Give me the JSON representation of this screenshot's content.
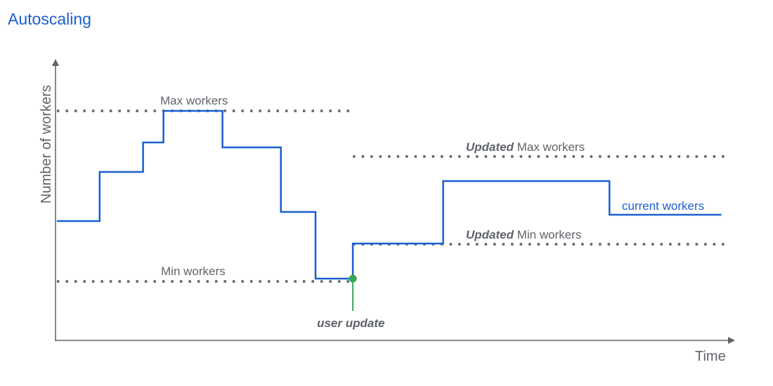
{
  "title": "Autoscaling",
  "colors": {
    "title": "#1a5fd1",
    "step_line": "#1a5fd1",
    "reference_lines": "#5f6368",
    "axis": "#5f6368",
    "user_update": "#34a853"
  },
  "chart_data": {
    "type": "line",
    "title": "Autoscaling",
    "xlabel": "Time",
    "ylabel": "Number of workers",
    "xlim": [
      0,
      100
    ],
    "ylim": [
      0,
      100
    ],
    "grid": false,
    "ticks": false,
    "series": [
      {
        "name": "current workers",
        "style": "step",
        "points": [
          [
            0.2,
            42.5
          ],
          [
            6.5,
            42.5
          ],
          [
            6.5,
            60
          ],
          [
            12.9,
            60
          ],
          [
            12.9,
            70.5
          ],
          [
            15.9,
            70.5
          ],
          [
            15.9,
            81.75
          ],
          [
            24.6,
            81.75
          ],
          [
            24.6,
            68.75
          ],
          [
            33.2,
            68.75
          ],
          [
            33.2,
            45.75
          ],
          [
            38.3,
            45.75
          ],
          [
            38.3,
            22
          ],
          [
            43.8,
            22
          ],
          [
            43.8,
            34.5
          ],
          [
            57.1,
            34.5
          ],
          [
            57.1,
            56.75
          ],
          [
            81.6,
            56.75
          ],
          [
            81.6,
            44.75
          ],
          [
            98.1,
            44.75
          ]
        ]
      }
    ],
    "reference_lines": [
      {
        "name": "Max workers",
        "label": "Max workers",
        "y": 81.75,
        "x_range": [
          0.2,
          43.8
        ]
      },
      {
        "name": "Min workers",
        "label": "Min workers",
        "y": 21,
        "x_range": [
          0.2,
          43.8
        ]
      },
      {
        "name": "Updated Max workers",
        "label_emphasis": "Updated",
        "label_rest": " Max workers",
        "y": 65.5,
        "x_range": [
          43.8,
          99
        ]
      },
      {
        "name": "Updated Min workers",
        "label_emphasis": "Updated",
        "label_rest": " Min workers",
        "y": 34.25,
        "x_range": [
          43.8,
          99
        ]
      }
    ],
    "annotations": [
      {
        "name": "user update",
        "text": "user update",
        "x": 43.8,
        "y": 22
      },
      {
        "name": "current workers",
        "text": "current workers",
        "x": 83.5,
        "y": 47.5
      }
    ]
  }
}
